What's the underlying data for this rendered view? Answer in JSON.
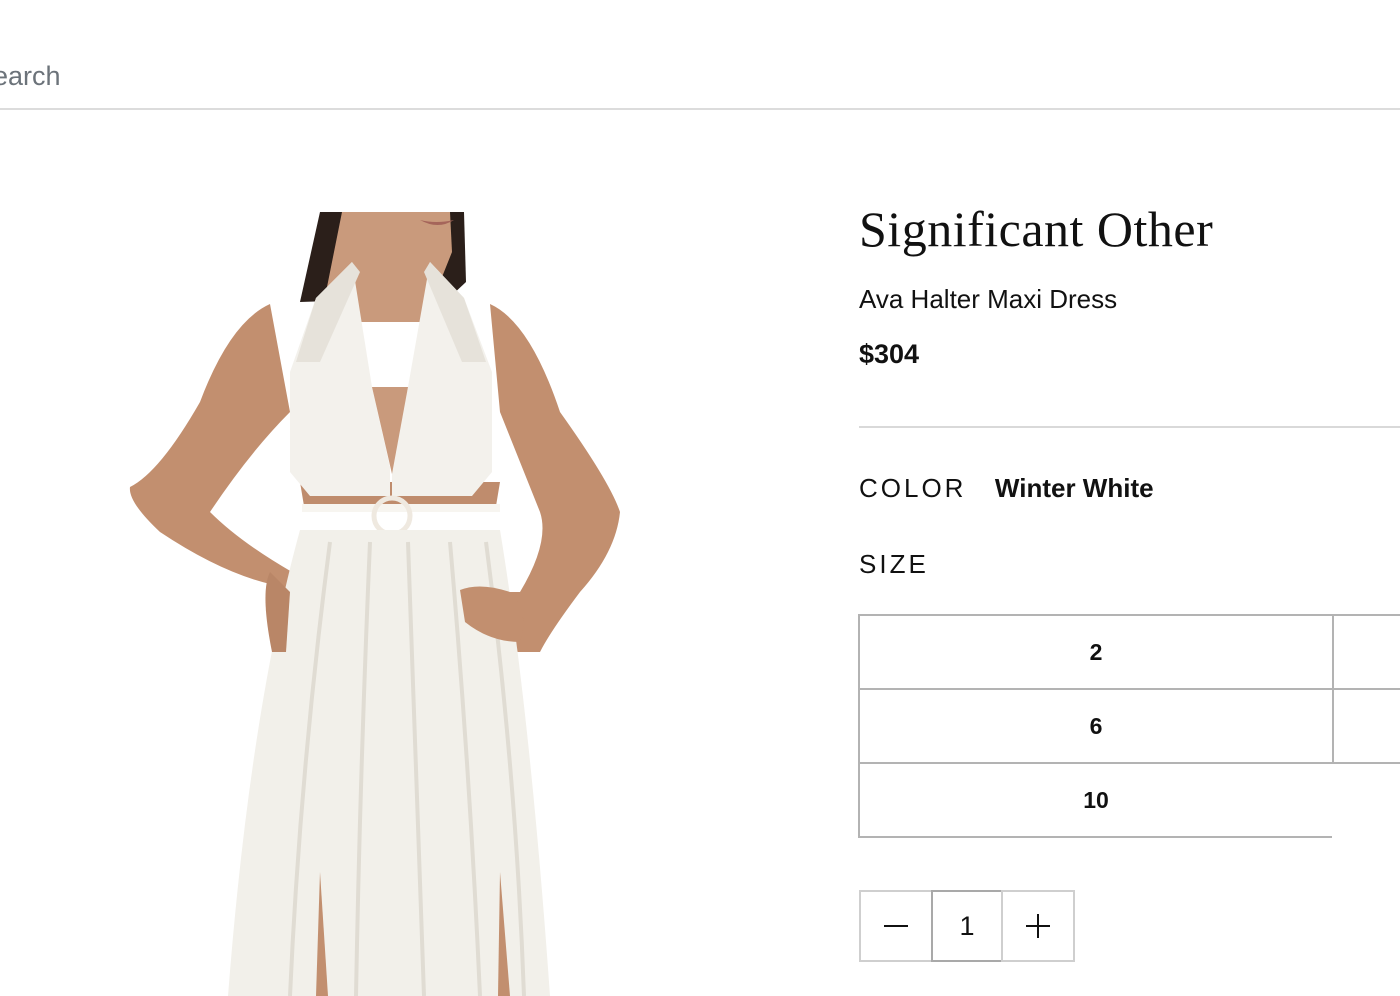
{
  "search": {
    "placeholder": "Search"
  },
  "product": {
    "image_alt": "Model wearing white halter maxi dress with cut-outs and ring detail",
    "brand": "Significant Other",
    "name": "Ava Halter Maxi Dress",
    "price": "$304",
    "color_label": "COLOR",
    "color_value": "Winter White",
    "size_label": "SIZE",
    "sizes": [
      {
        "label": "2"
      },
      {
        "label": ""
      },
      {
        "label": "6"
      },
      {
        "label": ""
      },
      {
        "label": "10"
      },
      {
        "label": ""
      }
    ]
  },
  "quantity": {
    "value": "1",
    "minus_icon": "minus-icon",
    "plus_icon": "plus-icon"
  },
  "colors": {
    "text": "#111111",
    "placeholder": "#6c737a",
    "border": "#b3b3b3",
    "divider": "#d9d9d9"
  }
}
